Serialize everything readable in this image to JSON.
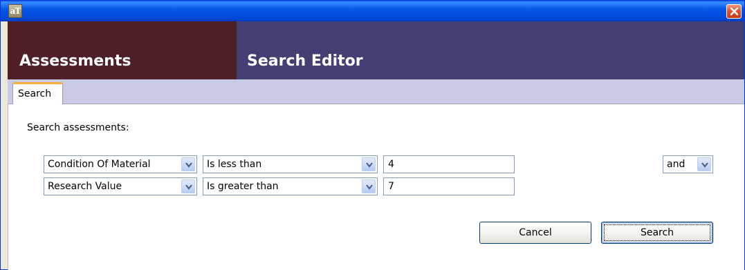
{
  "window": {
    "app_icon_text": "aT",
    "icons": {
      "app": "app-icon",
      "close": "close-icon"
    }
  },
  "header": {
    "section_title": "Assessments",
    "page_title": "Search Editor",
    "colors": {
      "section_bg": "#4f1f27",
      "page_bg": "#443f72",
      "tab_accent": "#f2b13c"
    }
  },
  "tabs": [
    {
      "label": "Search",
      "active": true
    }
  ],
  "search": {
    "intro": "Search assessments:",
    "rows": [
      {
        "field": "Condition Of Material",
        "operator": "Is less than",
        "value": "4"
      },
      {
        "field": "Research Value",
        "operator": "Is greater than",
        "value": "7"
      }
    ],
    "combinator": "and"
  },
  "actions": {
    "cancel_label": "Cancel",
    "search_label": "Search"
  }
}
